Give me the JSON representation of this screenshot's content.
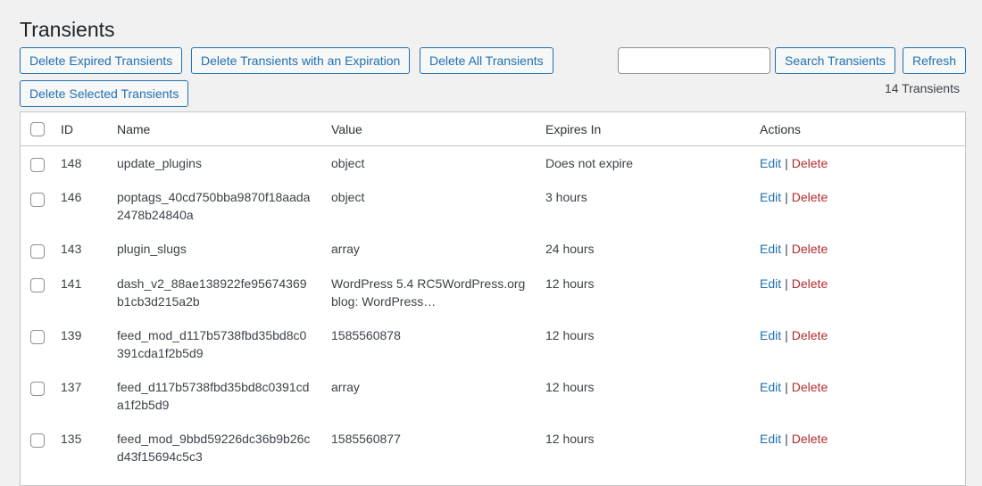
{
  "page": {
    "title": "Transients"
  },
  "toolbar": {
    "delete_expired": "Delete Expired Transients",
    "delete_with_expiration": "Delete Transients with an Expiration",
    "delete_all": "Delete All Transients",
    "delete_selected": "Delete Selected Transients",
    "search_value": "",
    "search_placeholder": "",
    "search_button": "Search Transients",
    "refresh_button": "Refresh",
    "count": "14 Transients"
  },
  "table": {
    "headers": {
      "id": "ID",
      "name": "Name",
      "value": "Value",
      "expires": "Expires In",
      "actions": "Actions"
    },
    "action_edit": "Edit",
    "action_separator": "|",
    "action_delete": "Delete",
    "rows": [
      {
        "id": "148",
        "name": "update_plugins",
        "value": "object",
        "expires": "Does not expire"
      },
      {
        "id": "146",
        "name": "poptags_40cd750bba9870f18aada2478b24840a",
        "value": "object",
        "expires": "3 hours"
      },
      {
        "id": "143",
        "name": "plugin_slugs",
        "value": "array",
        "expires": "24 hours"
      },
      {
        "id": "141",
        "name": "dash_v2_88ae138922fe95674369b1cb3d215a2b",
        "value": "WordPress 5.4 RC5WordPress.org blog: WordPress…",
        "expires": "12 hours"
      },
      {
        "id": "139",
        "name": "feed_mod_d117b5738fbd35bd8c0391cda1f2b5d9",
        "value": "1585560878",
        "expires": "12 hours"
      },
      {
        "id": "137",
        "name": "feed_d117b5738fbd35bd8c0391cda1f2b5d9",
        "value": "array",
        "expires": "12 hours"
      },
      {
        "id": "135",
        "name": "feed_mod_9bbd59226dc36b9b26cd43f15694c5c3",
        "value": "1585560877",
        "expires": "12 hours"
      }
    ]
  }
}
